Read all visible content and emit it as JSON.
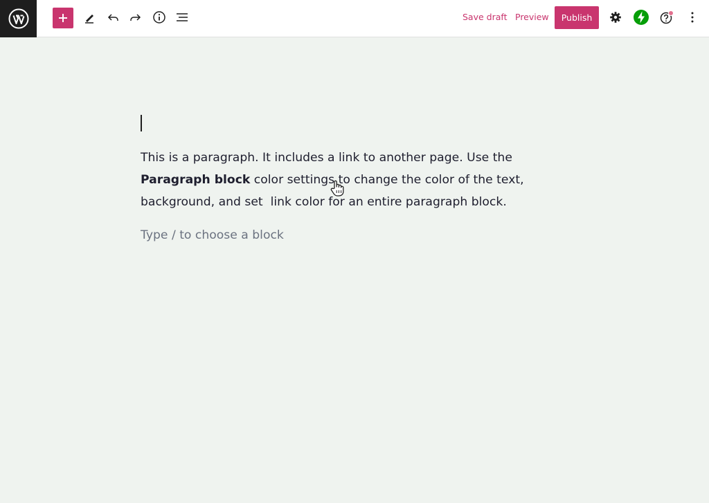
{
  "toolbar": {
    "logo_icon": "wordpress-logo-icon",
    "inserter_icon": "plus-icon",
    "tools": [
      {
        "name": "edit-tool-icon"
      },
      {
        "name": "undo-icon"
      },
      {
        "name": "redo-icon"
      },
      {
        "name": "info-icon"
      },
      {
        "name": "list-view-icon"
      }
    ],
    "save_draft_label": "Save draft",
    "preview_label": "Preview",
    "publish_label": "Publish",
    "accent_color": "#c9356e",
    "jetpack_color": "#069e08",
    "help_badge_color": "#e26f8e"
  },
  "editor": {
    "paragraph": {
      "line1": "This is a paragraph. It includes a link to another page. Use the",
      "bold_text": "Paragraph block",
      "line2_rest": " color settings to change the color of the text,",
      "line3": "background, and set  link color for an entire paragraph block."
    },
    "placeholder": "Type / to choose a block"
  }
}
